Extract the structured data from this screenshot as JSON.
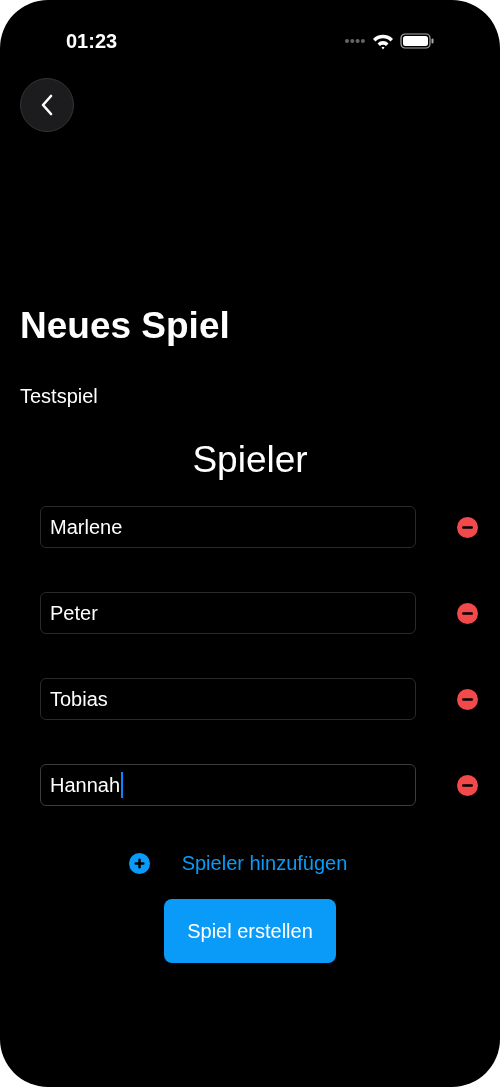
{
  "status_bar": {
    "time": "01:23"
  },
  "title": "Neues Spiel",
  "game_name": "Testspiel",
  "players_heading": "Spieler",
  "players": [
    {
      "name": "Marlene",
      "focused": false
    },
    {
      "name": "Peter",
      "focused": false
    },
    {
      "name": "Tobias",
      "focused": false
    },
    {
      "name": "Hannah",
      "focused": true
    }
  ],
  "add_player": "Spieler hinzufügen",
  "create_button": "Spiel erstellen"
}
